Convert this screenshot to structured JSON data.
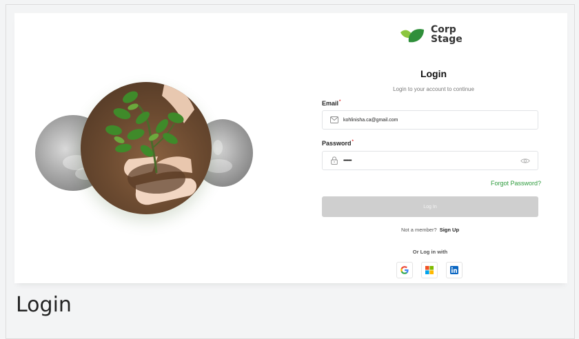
{
  "caption": "Login",
  "brand": {
    "line1": "Corp",
    "line2": "Stage",
    "leaf_dark": "#2f8f3a",
    "leaf_light": "#8cc63f"
  },
  "form": {
    "title": "Login",
    "subtitle": "Login to your account to continue",
    "email": {
      "label": "Email",
      "required_mark": "*",
      "value": "kohlinisha.ca@gmail.com",
      "icon": "mail-icon"
    },
    "password": {
      "label": "Password",
      "required_mark": "*",
      "value": "••••••••",
      "icon": "lock-icon",
      "toggle_icon": "eye-icon"
    },
    "forgot_label": "Forgot Password?",
    "login_label": "Log In",
    "signup_prompt": "Not a member?",
    "signup_label": "Sign Up",
    "or_label": "Or Log in with",
    "socials": [
      {
        "name": "google",
        "icon": "google-icon"
      },
      {
        "name": "microsoft",
        "icon": "microsoft-icon"
      },
      {
        "name": "linkedin",
        "icon": "linkedin-icon"
      }
    ]
  },
  "colors": {
    "accent": "#2d9b3c",
    "button_disabled": "#cfcfcf",
    "linkedin": "#0a66c2"
  }
}
